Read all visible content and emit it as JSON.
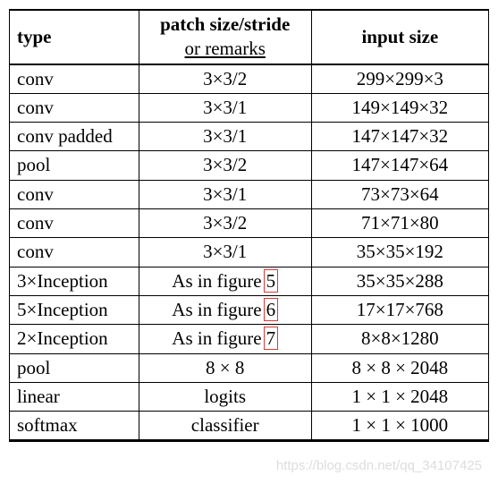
{
  "chart_data": {
    "type": "table",
    "headers": {
      "col1": "type",
      "col2_main": "patch size/stride",
      "col2_sub": "or remarks",
      "col3": "input size"
    },
    "rows": [
      {
        "type": "conv",
        "remark": "3×3/2",
        "input": "299×299×3"
      },
      {
        "type": "conv",
        "remark": "3×3/1",
        "input": "149×149×32"
      },
      {
        "type": "conv padded",
        "remark": "3×3/1",
        "input": "147×147×32"
      },
      {
        "type": "pool",
        "remark": "3×3/2",
        "input": "147×147×64"
      },
      {
        "type": "conv",
        "remark": "3×3/1",
        "input": "73×73×64"
      },
      {
        "type": "conv",
        "remark": "3×3/2",
        "input": "71×71×80"
      },
      {
        "type": "conv",
        "remark": "3×3/1",
        "input": "35×35×192"
      },
      {
        "type": "3×Inception",
        "remark": "As in figure",
        "ref": "5",
        "input": "35×35×288"
      },
      {
        "type": "5×Inception",
        "remark": "As in figure",
        "ref": "6",
        "input": "17×17×768"
      },
      {
        "type": "2×Inception",
        "remark": "As in figure",
        "ref": "7",
        "input": "8×8×1280"
      },
      {
        "type": "pool",
        "remark": "8 × 8",
        "input": "8 × 8 × 2048"
      },
      {
        "type": "linear",
        "remark": "logits",
        "input": "1 × 1 × 2048"
      },
      {
        "type": "softmax",
        "remark": "classifier",
        "input": "1 × 1 × 1000"
      }
    ]
  },
  "watermark": "https://blog.csdn.net/qq_34107425"
}
